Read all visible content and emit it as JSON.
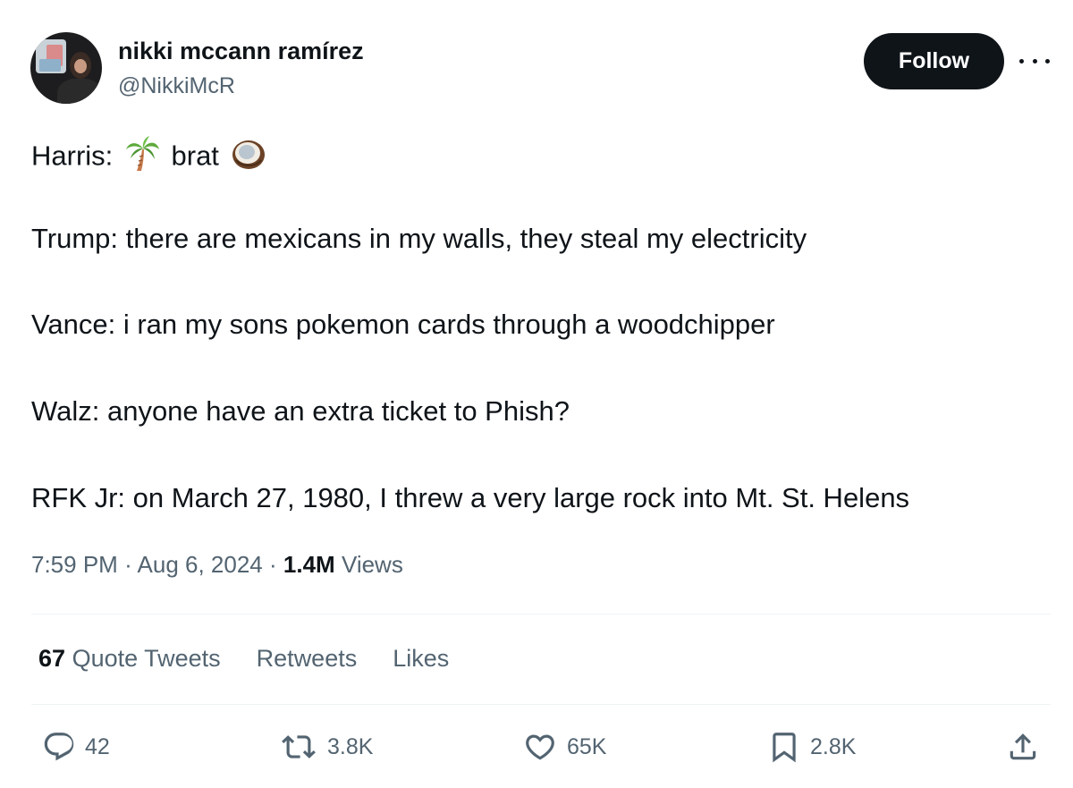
{
  "author": {
    "display_name": "nikki mccann ramírez",
    "handle": "@NikkiMcR"
  },
  "follow_label": "Follow",
  "tweet": {
    "lines": [
      {
        "prefix": "Harris: ",
        "middle": " brat ",
        "emojis": [
          "palm-tree",
          "coconut"
        ]
      },
      {
        "text": "Trump:  there are mexicans in my walls, they steal my electricity"
      },
      {
        "text": "Vance: i ran my sons pokemon cards through a woodchipper"
      },
      {
        "text": "Walz: anyone have an extra ticket to Phish?"
      },
      {
        "text": "RFK Jr: on March 27, 1980, I threw a very large rock into Mt. St. Helens"
      }
    ]
  },
  "meta": {
    "time": "7:59 PM",
    "separator": "·",
    "date": "Aug 6, 2024",
    "views_count": "1.4M",
    "views_label": "Views"
  },
  "stats": {
    "quote_count": "67",
    "quote_label": "Quote Tweets",
    "retweets_label": "Retweets",
    "likes_label": "Likes"
  },
  "actions": {
    "replies": "42",
    "retweets": "3.8K",
    "likes": "65K",
    "bookmarks": "2.8K"
  },
  "colors": {
    "text": "#0f1419",
    "secondary": "#536471",
    "divider": "#eff3f4",
    "follow_bg": "#0f1419"
  }
}
